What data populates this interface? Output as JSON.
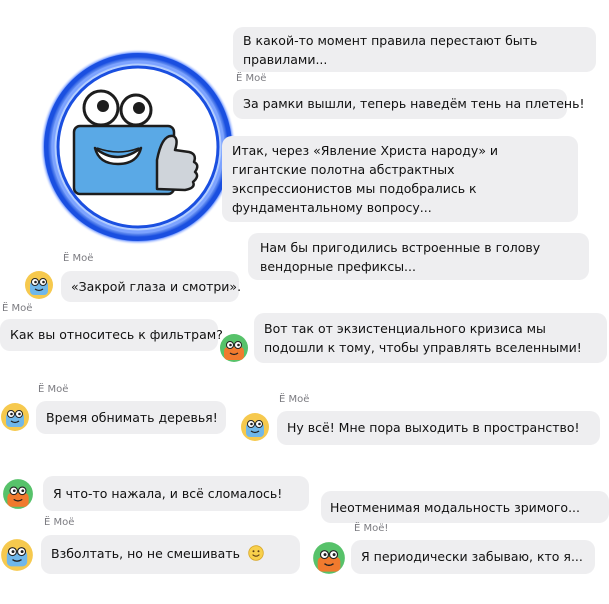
{
  "author_label": "Ё Моё",
  "author_label_alt": "Ё Моё!",
  "messages": [
    {
      "id": "m1",
      "lines": [
        "В какой-то момент правила перестают быть",
        "правилами..."
      ]
    },
    {
      "id": "m2",
      "lines": [
        "За рамки вышли, теперь наведём тень на плетень!"
      ]
    },
    {
      "id": "m3",
      "lines": [
        "Итак, через «Явление Христа народу» и",
        "гигантские полотна абстрактных",
        "экспрессионистов мы подобрались к",
        "фундаментальному вопросу..."
      ]
    },
    {
      "id": "m4",
      "lines": [
        "Нам бы пригодились встроенные в голову",
        "вендорные префиксы..."
      ]
    },
    {
      "id": "m5",
      "lines": [
        "«Закрой глаза и смотри»."
      ]
    },
    {
      "id": "m6",
      "lines": [
        "Как вы относитесь к фильтрам?"
      ]
    },
    {
      "id": "m7",
      "lines": [
        "Вот так от экзистенциального кризиса мы",
        "подошли к тому, чтобы управлять вселенными!"
      ]
    },
    {
      "id": "m8",
      "lines": [
        "Время обнимать деревья!"
      ]
    },
    {
      "id": "m9",
      "lines": [
        "Ну всё! Мне пора выходить в пространство!"
      ]
    },
    {
      "id": "m10",
      "lines": [
        "Я что-то нажала, и всё сломалось!"
      ]
    },
    {
      "id": "m11",
      "lines": [
        "Неотменимая модальность зримого..."
      ]
    },
    {
      "id": "m12",
      "lines": [
        "Взболтать, но не смешивать"
      ]
    },
    {
      "id": "m13",
      "lines": [
        "Я периодически забываю, кто я..."
      ]
    }
  ],
  "colors": {
    "bubble": "#eeeef0",
    "author": "#7b7b80",
    "ring_blue": "#1a4fe0",
    "mascot_blue": "#5aa9e6",
    "avatar_yellow": "#f6c94e",
    "avatar_green": "#57c26a",
    "avatar_orange": "#f07a2e"
  }
}
